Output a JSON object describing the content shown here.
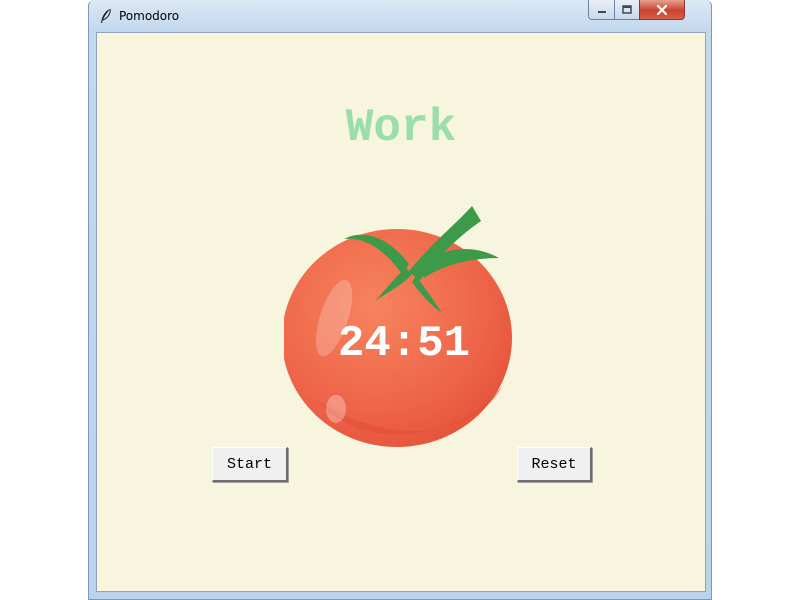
{
  "window": {
    "title": "Pomodoro",
    "icon": "feather-icon"
  },
  "title_bar": {
    "buttons": [
      "minimize-icon",
      "maximize-icon",
      "close-icon"
    ]
  },
  "main": {
    "mode_label": "Work",
    "timer": "24:51",
    "start_label": "Start",
    "reset_label": "Reset"
  },
  "colors": {
    "background": "#f7f5dd",
    "mode_label": "#9bdeac",
    "tomato": "#ee6448",
    "leaves": "#3d9a48",
    "timer_text": "#ffffff"
  }
}
